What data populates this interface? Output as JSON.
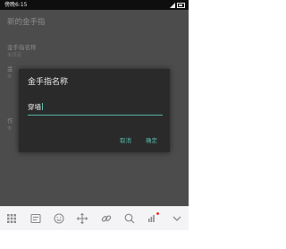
{
  "status_bar": {
    "time": "傍晚6:15"
  },
  "app": {
    "title": "新的金手指",
    "preferences": [
      {
        "title": "金手指名称",
        "summary": "未设定"
      },
      {
        "title": "金",
        "summary": "未"
      },
      {
        "title": "作",
        "summary": "未"
      }
    ]
  },
  "dialog": {
    "title": "金手指名称",
    "input_value": "穿墙",
    "cancel_label": "取消",
    "ok_label": "确定",
    "accent_color": "#58b8a8"
  },
  "keyboard_toolbar": {
    "icons": [
      "keyboard-grid-icon",
      "text-format-icon",
      "emoji-icon",
      "cursor-move-icon",
      "link-icon",
      "search-icon",
      "voice-notification-icon",
      "collapse-keyboard-icon"
    ]
  }
}
